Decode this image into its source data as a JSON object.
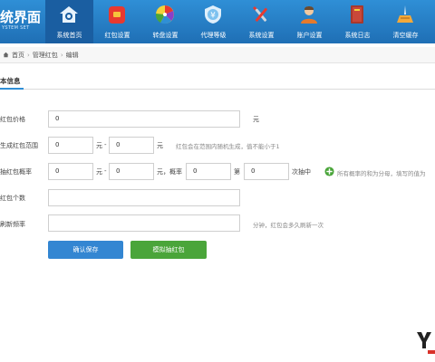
{
  "app": {
    "logo_title": "统界面",
    "logo_sub": "YSTEM SET"
  },
  "nav": [
    {
      "label": "系统首页",
      "icon": "home-icon",
      "active": true
    },
    {
      "label": "红包设置",
      "icon": "red-envelope-icon",
      "active": false
    },
    {
      "label": "转盘设置",
      "icon": "color-wheel-icon",
      "active": false
    },
    {
      "label": "代理等级",
      "icon": "shield-money-icon",
      "active": false
    },
    {
      "label": "系统设置",
      "icon": "tools-icon",
      "active": false
    },
    {
      "label": "账户设置",
      "icon": "user-icon",
      "active": false
    },
    {
      "label": "系统日志",
      "icon": "book-icon",
      "active": false
    },
    {
      "label": "清空缓存",
      "icon": "broom-icon",
      "active": false
    }
  ],
  "breadcrumb": {
    "home": "首页",
    "section": "管理红包",
    "current": "编辑",
    "sep": "›"
  },
  "section": {
    "title": "本信息"
  },
  "form": {
    "price": {
      "label": "红包价格",
      "value": "0",
      "unit": "元"
    },
    "range": {
      "label": "生成红包范围",
      "min": "0",
      "max": "0",
      "unit": "元",
      "dash": "-",
      "hint": "红包会在范围内随机生成，值不能小于1"
    },
    "prob": {
      "label": "抽红包概率",
      "min": "0",
      "max": "0",
      "unit": "元",
      "dash": "-",
      "prob_label": "，概率",
      "p1": "0",
      "between": "第",
      "p2": "0",
      "suffix": "次抽中",
      "hint": "所有概率的和为分母，填写的值为"
    },
    "count": {
      "label": "红包个数",
      "value": ""
    },
    "refresh": {
      "label": "刷新频率",
      "value": "",
      "hint": "分钟，红包会多久刷新一次"
    }
  },
  "buttons": {
    "save": "确认保存",
    "simulate": "模拟抽红包"
  },
  "colors": {
    "nav_bg": "#2f8fd6",
    "nav_active": "#1a5ea1",
    "save": "#3386d2",
    "simulate": "#4aa53a"
  }
}
